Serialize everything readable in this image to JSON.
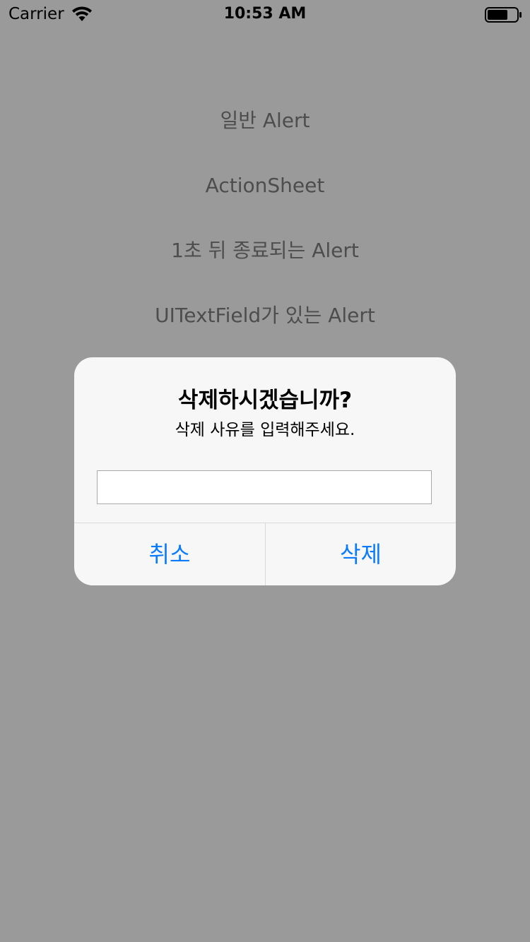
{
  "status_bar": {
    "carrier": "Carrier",
    "time": "10:53 AM",
    "wifi_icon": "wifi-icon",
    "battery_icon": "battery-icon"
  },
  "menu": {
    "items": [
      {
        "label": "일반 Alert"
      },
      {
        "label": "ActionSheet"
      },
      {
        "label": "1초 뒤 종료되는 Alert"
      },
      {
        "label": "UITextField가 있는 Alert"
      }
    ]
  },
  "alert": {
    "title": "삭제하시겠습니까?",
    "message": "삭제 사유를 입력해주세요.",
    "input_value": "",
    "cancel_label": "취소",
    "delete_label": "삭제"
  },
  "colors": {
    "dim_background": "#9a9a9a",
    "alert_background": "#f7f7f7",
    "accent": "#0a7aff"
  }
}
